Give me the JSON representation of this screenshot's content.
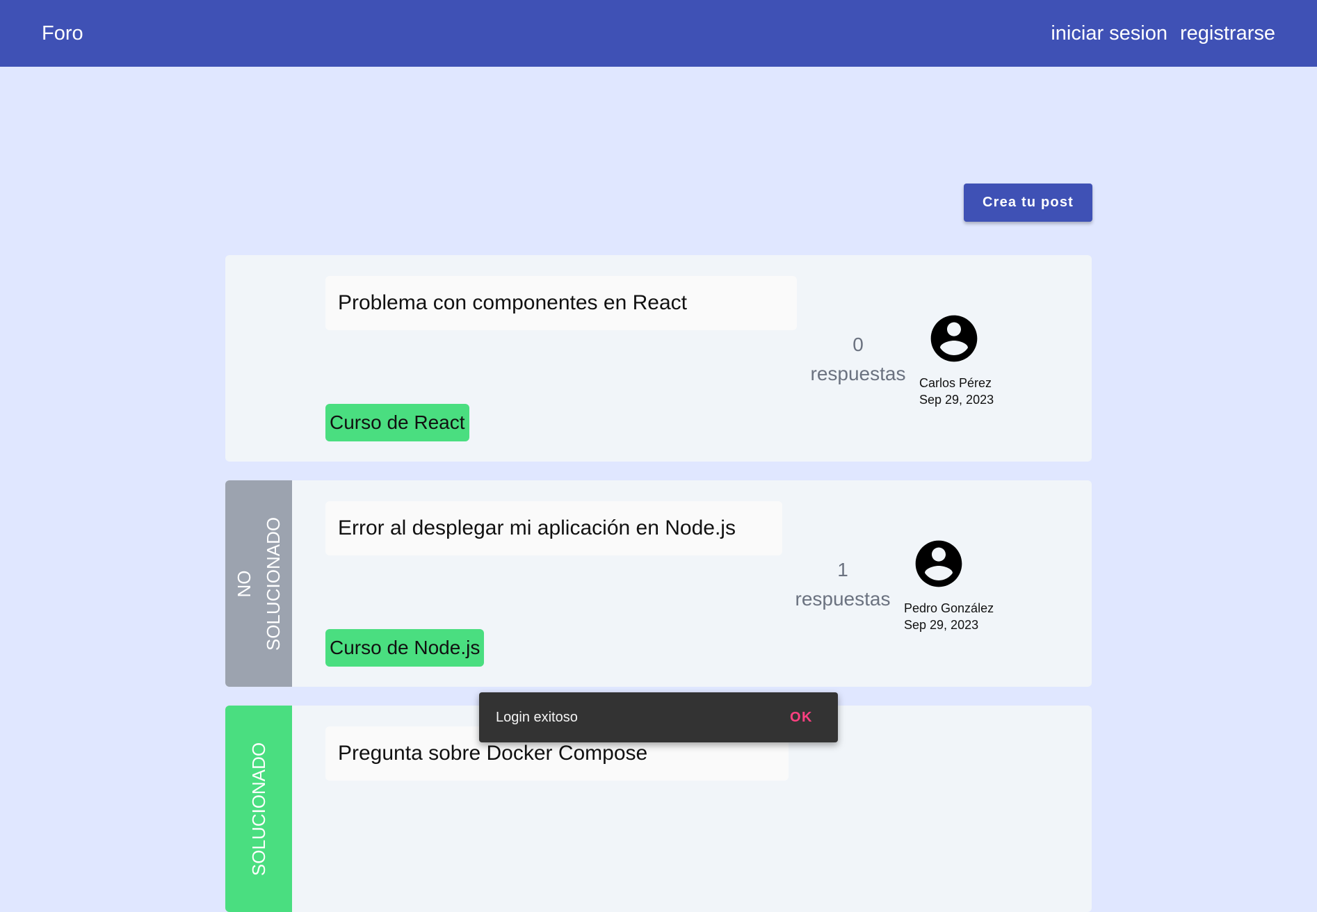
{
  "header": {
    "brand": "Foro",
    "nav": {
      "login": "iniciar sesion",
      "register": "registrarse"
    }
  },
  "actions": {
    "create_post": "Crea tu post"
  },
  "posts": [
    {
      "title": "Problema con componentes en React",
      "course": "Curso de React",
      "answers_count": "0",
      "answers_label": "respuestas",
      "author": "Carlos Pérez",
      "date": "Sep 29, 2023",
      "status": ""
    },
    {
      "title": "Error al desplegar mi aplicación en Node.js",
      "course": "Curso de Node.js",
      "answers_count": "1",
      "answers_label": "respuestas",
      "author": "Pedro González",
      "date": "Sep 29, 2023",
      "status": "NO SOLUCIONADO"
    },
    {
      "title": "Pregunta sobre Docker Compose",
      "status": "SOLUCIONADO"
    }
  ],
  "snackbar": {
    "message": "Login exitoso",
    "action": "OK"
  },
  "colors": {
    "primary": "#3f51b5",
    "background": "#e0e7ff",
    "card": "#f1f5f9",
    "tag": "#4ade80",
    "unsolved": "#9ca3af",
    "solved": "#4ade80",
    "snack_action": "#ff4081"
  },
  "icons": {
    "avatar": "account-circle-icon"
  }
}
